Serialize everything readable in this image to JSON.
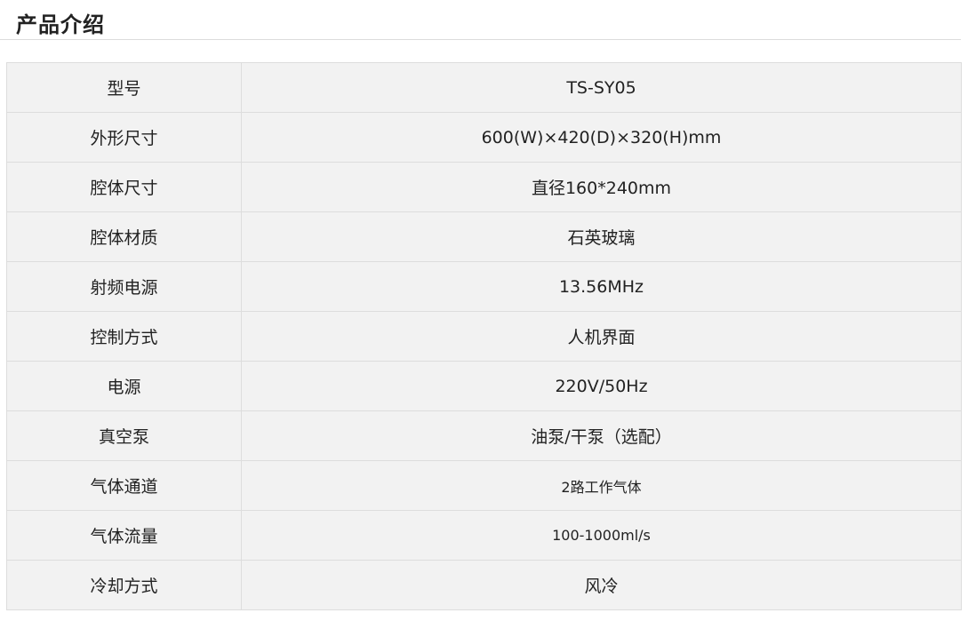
{
  "page": {
    "title": "产品介绍"
  },
  "specs": [
    {
      "label": "型号",
      "value": "TS-SY05"
    },
    {
      "label": "外形尺寸",
      "value": "600(W)×420(D)×320(H)mm"
    },
    {
      "label": "腔体尺寸",
      "value": "直径160*240mm"
    },
    {
      "label": "腔体材质",
      "value": "石英玻璃"
    },
    {
      "label": "射频电源",
      "value": "13.56MHz"
    },
    {
      "label": "控制方式",
      "value": "人机界面"
    },
    {
      "label": "电源",
      "value": "220V/50Hz"
    },
    {
      "label": "真空泵",
      "value": "油泵/干泵（选配）"
    },
    {
      "label": "气体通道",
      "value": "2路工作气体"
    },
    {
      "label": "气体流量",
      "value": "100-1000ml/s"
    },
    {
      "label": "冷却方式",
      "value": "风冷"
    }
  ]
}
